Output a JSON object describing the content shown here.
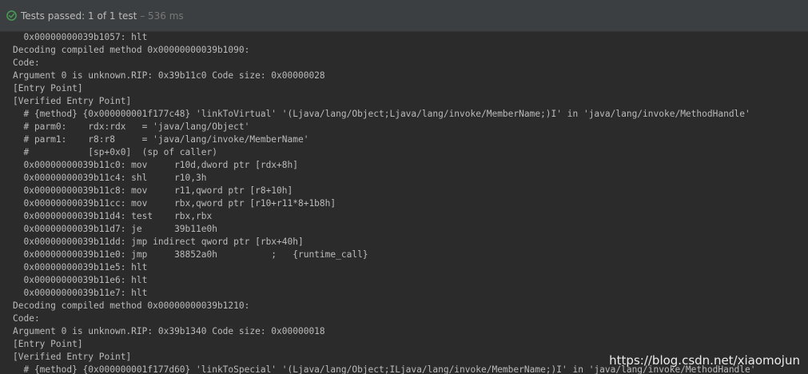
{
  "status": {
    "label": "Tests passed:",
    "count": "1 of 1 test",
    "time": "– 536 ms",
    "icon": "check-circle-icon",
    "icon_color": "#499c54"
  },
  "console": {
    "lines": [
      "  0x00000000039b1057: hlt",
      "Decoding compiled method 0x00000000039b1090:",
      "Code:",
      "Argument 0 is unknown.RIP: 0x39b11c0 Code size: 0x00000028",
      "[Entry Point]",
      "[Verified Entry Point]",
      "  # {method} {0x000000001f177c48} 'linkToVirtual' '(Ljava/lang/Object;Ljava/lang/invoke/MemberName;)I' in 'java/lang/invoke/MethodHandle'",
      "  # parm0:    rdx:rdx   = 'java/lang/Object'",
      "  # parm1:    r8:r8     = 'java/lang/invoke/MemberName'",
      "  #           [sp+0x0]  (sp of caller)",
      "  0x00000000039b11c0: mov     r10d,dword ptr [rdx+8h]",
      "  0x00000000039b11c4: shl     r10,3h",
      "  0x00000000039b11c8: mov     r11,qword ptr [r8+10h]",
      "  0x00000000039b11cc: mov     rbx,qword ptr [r10+r11*8+1b8h]",
      "  0x00000000039b11d4: test    rbx,rbx",
      "  0x00000000039b11d7: je      39b11e0h",
      "  0x00000000039b11dd: jmp indirect qword ptr [rbx+40h]",
      "  0x00000000039b11e0: jmp     38852a0h          ;   {runtime_call}",
      "  0x00000000039b11e5: hlt",
      "  0x00000000039b11e6: hlt",
      "  0x00000000039b11e7: hlt",
      "Decoding compiled method 0x00000000039b1210:",
      "Code:",
      "Argument 0 is unknown.RIP: 0x39b1340 Code size: 0x00000018",
      "[Entry Point]",
      "[Verified Entry Point]",
      "  # {method} {0x000000001f177d60} 'linkToSpecial' '(Ljava/lang/Object;ILjava/lang/invoke/MemberName;)I' in 'java/lang/invoke/MethodHandle'"
    ]
  },
  "watermark": "https://blog.csdn.net/xiaomojun"
}
